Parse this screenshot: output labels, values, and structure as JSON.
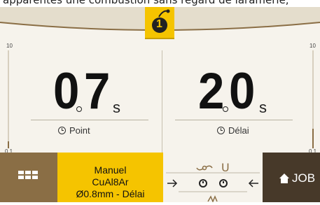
{
  "window": {
    "top_caption": "apparentes une combustion sans regard de laramerie,"
  },
  "header": {
    "mode_number": "1",
    "mode_icon": "torch-icon"
  },
  "gauges": {
    "left": {
      "max_label": "10",
      "min_label": "0.1",
      "level": 0.07
    },
    "right": {
      "max_label": "10",
      "min_label": "0.1",
      "level": 0.2
    }
  },
  "left_value": {
    "integer": "0",
    "decimal": "7",
    "unit": "s",
    "caption": "Point"
  },
  "right_value": {
    "integer": "2",
    "decimal": "0",
    "unit": "s",
    "caption": "Délai"
  },
  "bottom": {
    "grid_icon": "grid-icon",
    "job_panel": {
      "line1": "Manuel",
      "line2": "CuAl8Ar",
      "line3": "Ø0.8mm - Délai"
    },
    "process": {
      "top_symbol": "U"
    },
    "job_button_label": "JOB",
    "job_icon": "home-icon"
  },
  "colors": {
    "accent": "#f5c400",
    "brown": "#8a6e45",
    "dark_brown": "#473929",
    "background": "#f6f3ec"
  }
}
